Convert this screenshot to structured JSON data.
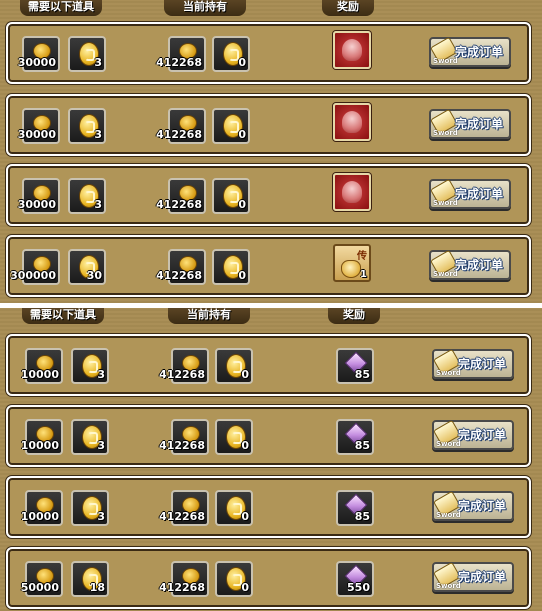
{
  "panels": [
    {
      "headers": {
        "required": "需要以下道具",
        "held": "当前持有",
        "reward": "奖励"
      },
      "rows": [
        {
          "req_coin": "30000",
          "req_ticket": "3",
          "held_coin": "412268",
          "held_ticket": "0",
          "reward_type": "red-emblem",
          "reward_count": "",
          "button": "完成订单",
          "button_sub": "Sword"
        },
        {
          "req_coin": "30000",
          "req_ticket": "3",
          "held_coin": "412268",
          "held_ticket": "0",
          "reward_type": "red-emblem",
          "reward_count": "",
          "button": "完成订单",
          "button_sub": "Sword"
        },
        {
          "req_coin": "30000",
          "req_ticket": "3",
          "held_coin": "412268",
          "held_ticket": "0",
          "reward_type": "red-emblem",
          "reward_count": "",
          "button": "完成订单",
          "button_sub": "Sword"
        },
        {
          "req_coin": "300000",
          "req_ticket": "30",
          "held_coin": "412268",
          "held_ticket": "0",
          "reward_type": "legend-bag",
          "reward_tag": "传",
          "reward_count": "1",
          "button": "完成订单",
          "button_sub": "Sword"
        }
      ]
    },
    {
      "headers": {
        "required": "需要以下道具",
        "held": "当前持有",
        "reward": "奖励"
      },
      "rows": [
        {
          "req_coin": "10000",
          "req_ticket": "3",
          "held_coin": "412268",
          "held_ticket": "0",
          "reward_type": "gem",
          "reward_count": "85",
          "button": "完成订单",
          "button_sub": "Sword"
        },
        {
          "req_coin": "10000",
          "req_ticket": "3",
          "held_coin": "412268",
          "held_ticket": "0",
          "reward_type": "gem",
          "reward_count": "85",
          "button": "完成订单",
          "button_sub": "Sword"
        },
        {
          "req_coin": "10000",
          "req_ticket": "3",
          "held_coin": "412268",
          "held_ticket": "0",
          "reward_type": "gem",
          "reward_count": "85",
          "button": "完成订单",
          "button_sub": "Sword"
        },
        {
          "req_coin": "50000",
          "req_ticket": "18",
          "held_coin": "412268",
          "held_ticket": "0",
          "reward_type": "gem",
          "reward_count": "550",
          "button": "完成订单",
          "button_sub": "Sword"
        }
      ]
    }
  ],
  "colors": {
    "panel": "#a88d54",
    "row_border": "#ffffff",
    "slot_bg": "#1b1b1b",
    "button_text_outline": "#1d3a6a"
  }
}
